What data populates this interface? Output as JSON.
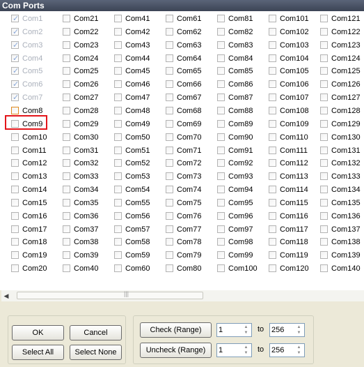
{
  "window": {
    "title": "Com Ports"
  },
  "ports": [
    {
      "label": "Com1",
      "checked": true,
      "disabled": true
    },
    {
      "label": "Com2",
      "checked": true,
      "disabled": true
    },
    {
      "label": "Com3",
      "checked": true,
      "disabled": true
    },
    {
      "label": "Com4",
      "checked": true,
      "disabled": true
    },
    {
      "label": "Com5",
      "checked": true,
      "disabled": true
    },
    {
      "label": "Com6",
      "checked": true,
      "disabled": true
    },
    {
      "label": "Com7",
      "checked": true,
      "disabled": true
    },
    {
      "label": "Com8",
      "checked": false,
      "focused": true
    },
    {
      "label": "Com9"
    },
    {
      "label": "Com10"
    },
    {
      "label": "Com11"
    },
    {
      "label": "Com12"
    },
    {
      "label": "Com13"
    },
    {
      "label": "Com14"
    },
    {
      "label": "Com15"
    },
    {
      "label": "Com16"
    },
    {
      "label": "Com17"
    },
    {
      "label": "Com18"
    },
    {
      "label": "Com19"
    },
    {
      "label": "Com20"
    },
    {
      "label": "Com21"
    },
    {
      "label": "Com22"
    },
    {
      "label": "Com23"
    },
    {
      "label": "Com24"
    },
    {
      "label": "Com25"
    },
    {
      "label": "Com26"
    },
    {
      "label": "Com27"
    },
    {
      "label": "Com28"
    },
    {
      "label": "Com29"
    },
    {
      "label": "Com30"
    },
    {
      "label": "Com31"
    },
    {
      "label": "Com32"
    },
    {
      "label": "Com33"
    },
    {
      "label": "Com34"
    },
    {
      "label": "Com35"
    },
    {
      "label": "Com36"
    },
    {
      "label": "Com37"
    },
    {
      "label": "Com38"
    },
    {
      "label": "Com39"
    },
    {
      "label": "Com40"
    },
    {
      "label": "Com41"
    },
    {
      "label": "Com42"
    },
    {
      "label": "Com43"
    },
    {
      "label": "Com44"
    },
    {
      "label": "Com45"
    },
    {
      "label": "Com46"
    },
    {
      "label": "Com47"
    },
    {
      "label": "Com48"
    },
    {
      "label": "Com49"
    },
    {
      "label": "Com50"
    },
    {
      "label": "Com51"
    },
    {
      "label": "Com52"
    },
    {
      "label": "Com53"
    },
    {
      "label": "Com54"
    },
    {
      "label": "Com55"
    },
    {
      "label": "Com56"
    },
    {
      "label": "Com57"
    },
    {
      "label": "Com58"
    },
    {
      "label": "Com59"
    },
    {
      "label": "Com60"
    },
    {
      "label": "Com61"
    },
    {
      "label": "Com62"
    },
    {
      "label": "Com63"
    },
    {
      "label": "Com64"
    },
    {
      "label": "Com65"
    },
    {
      "label": "Com66"
    },
    {
      "label": "Com67"
    },
    {
      "label": "Com68"
    },
    {
      "label": "Com69"
    },
    {
      "label": "Com70"
    },
    {
      "label": "Com71"
    },
    {
      "label": "Com72"
    },
    {
      "label": "Com73"
    },
    {
      "label": "Com74"
    },
    {
      "label": "Com75"
    },
    {
      "label": "Com76"
    },
    {
      "label": "Com77"
    },
    {
      "label": "Com78"
    },
    {
      "label": "Com79"
    },
    {
      "label": "Com80"
    },
    {
      "label": "Com81"
    },
    {
      "label": "Com82"
    },
    {
      "label": "Com83"
    },
    {
      "label": "Com84"
    },
    {
      "label": "Com85"
    },
    {
      "label": "Com86"
    },
    {
      "label": "Com87"
    },
    {
      "label": "Com88"
    },
    {
      "label": "Com89"
    },
    {
      "label": "Com90"
    },
    {
      "label": "Com91"
    },
    {
      "label": "Com92"
    },
    {
      "label": "Com93"
    },
    {
      "label": "Com94"
    },
    {
      "label": "Com95"
    },
    {
      "label": "Com96"
    },
    {
      "label": "Com97"
    },
    {
      "label": "Com98"
    },
    {
      "label": "Com99"
    },
    {
      "label": "Com100"
    },
    {
      "label": "Com101"
    },
    {
      "label": "Com102"
    },
    {
      "label": "Com103"
    },
    {
      "label": "Com104"
    },
    {
      "label": "Com105"
    },
    {
      "label": "Com106"
    },
    {
      "label": "Com107"
    },
    {
      "label": "Com108"
    },
    {
      "label": "Com109"
    },
    {
      "label": "Com110"
    },
    {
      "label": "Com111"
    },
    {
      "label": "Com112"
    },
    {
      "label": "Com113"
    },
    {
      "label": "Com114"
    },
    {
      "label": "Com115"
    },
    {
      "label": "Com116"
    },
    {
      "label": "Com117"
    },
    {
      "label": "Com118"
    },
    {
      "label": "Com119"
    },
    {
      "label": "Com120"
    },
    {
      "label": "Com121"
    },
    {
      "label": "Com122"
    },
    {
      "label": "Com123"
    },
    {
      "label": "Com124"
    },
    {
      "label": "Com125"
    },
    {
      "label": "Com126"
    },
    {
      "label": "Com127"
    },
    {
      "label": "Com128"
    },
    {
      "label": "Com129"
    },
    {
      "label": "Com130"
    },
    {
      "label": "Com131"
    },
    {
      "label": "Com132"
    },
    {
      "label": "Com133"
    },
    {
      "label": "Com134"
    },
    {
      "label": "Com135"
    },
    {
      "label": "Com136"
    },
    {
      "label": "Com137"
    },
    {
      "label": "Com138"
    },
    {
      "label": "Com139"
    },
    {
      "label": "Com140"
    }
  ],
  "buttons": {
    "ok": "OK",
    "cancel": "Cancel",
    "select_all": "Select All",
    "select_none": "Select None",
    "check_range": "Check (Range)",
    "uncheck_range": "Uncheck (Range)"
  },
  "range": {
    "check_from": "1",
    "check_to": "256",
    "uncheck_from": "1",
    "uncheck_to": "256",
    "to_label": "to"
  },
  "colors": {
    "highlight": "#e3151a",
    "disabled_text": "#aab0bb"
  }
}
